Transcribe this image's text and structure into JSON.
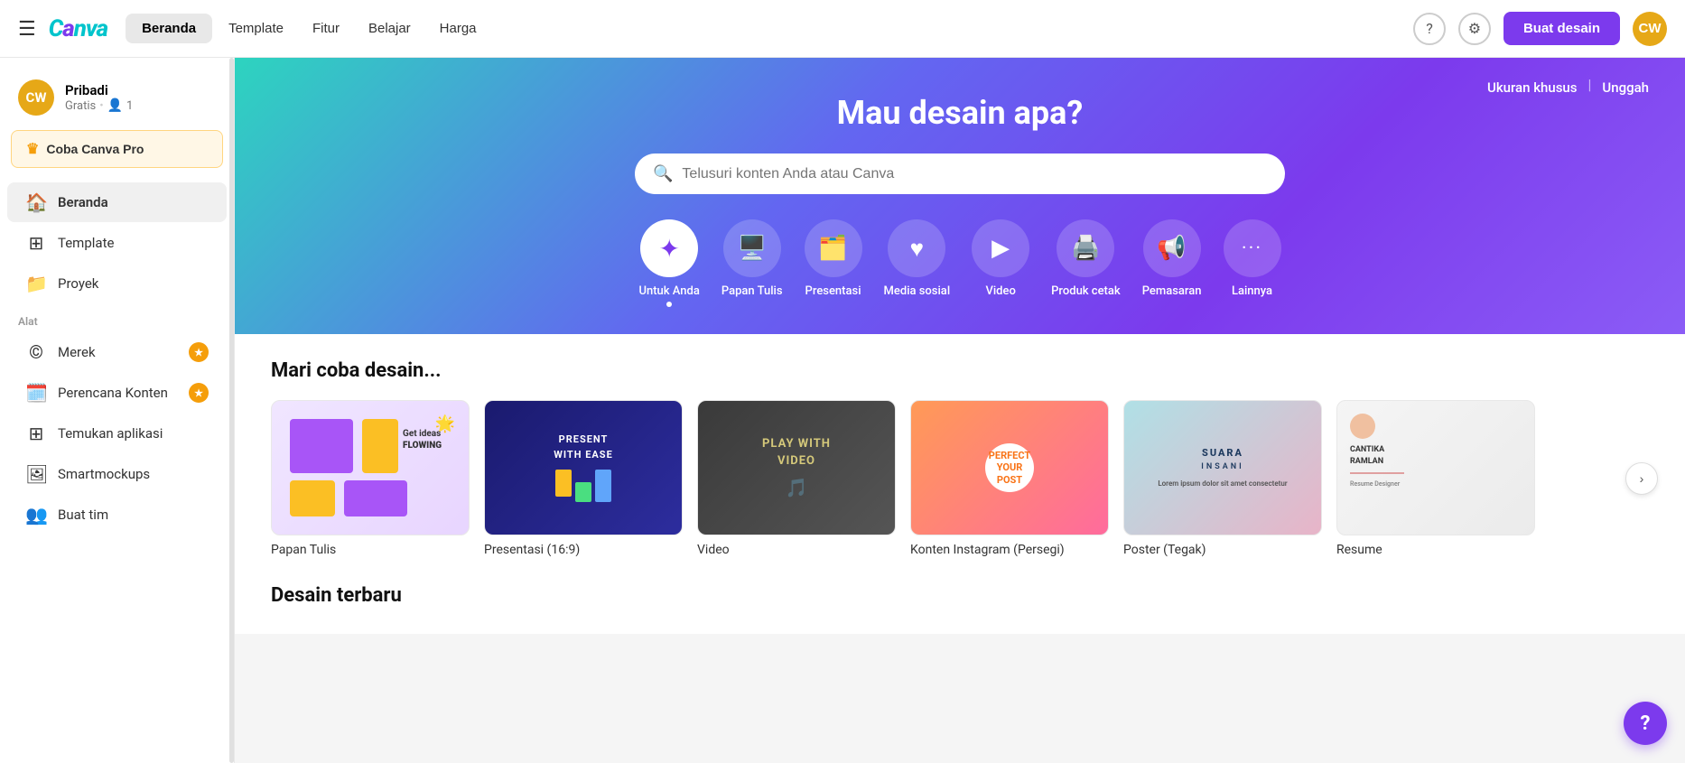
{
  "topnav": {
    "logo": "Canva",
    "beranda_label": "Beranda",
    "template_label": "Template",
    "fitur_label": "Fitur",
    "belajar_label": "Belajar",
    "harga_label": "Harga",
    "buat_desain_label": "Buat desain",
    "user_initials": "CW"
  },
  "sidebar": {
    "user_name": "Pribadi",
    "user_plan": "Gratis",
    "user_member_count": "1",
    "user_initials": "CW",
    "coba_canva_pro": "Coba Canva Pro",
    "nav_items": [
      {
        "id": "beranda",
        "label": "Beranda",
        "icon": "🏠",
        "active": true
      },
      {
        "id": "template",
        "label": "Template",
        "icon": "⊞",
        "active": false
      },
      {
        "id": "proyek",
        "label": "Proyek",
        "icon": "📁",
        "active": false
      }
    ],
    "section_alat": "Alat",
    "tool_items": [
      {
        "id": "merek",
        "label": "Merek",
        "icon": "©",
        "badge": true
      },
      {
        "id": "perencana-konten",
        "label": "Perencana Konten",
        "icon": "🗓️",
        "badge": true
      },
      {
        "id": "temukan-aplikasi",
        "label": "Temukan aplikasi",
        "icon": "⊞",
        "badge": false
      },
      {
        "id": "smartmockups",
        "label": "Smartmockups",
        "icon": "🖼",
        "badge": false
      },
      {
        "id": "buat-tim",
        "label": "Buat tim",
        "icon": "👥",
        "badge": false
      }
    ]
  },
  "hero": {
    "title": "Mau desain apa?",
    "search_placeholder": "Telusuri konten Anda atau Canva",
    "top_right_link1": "Ukuran khusus",
    "top_right_link2": "Unggah",
    "categories": [
      {
        "id": "untuk-anda",
        "label": "Untuk Anda",
        "icon": "✦",
        "active": true
      },
      {
        "id": "papan-tulis",
        "label": "Papan Tulis",
        "icon": "🖥"
      },
      {
        "id": "presentasi",
        "label": "Presentasi",
        "icon": "🗂"
      },
      {
        "id": "media-sosial",
        "label": "Media sosial",
        "icon": "♥"
      },
      {
        "id": "video",
        "label": "Video",
        "icon": "▶"
      },
      {
        "id": "produk-cetak",
        "label": "Produk cetak",
        "icon": "🖨"
      },
      {
        "id": "pemasaran",
        "label": "Pemasaran",
        "icon": "📢"
      },
      {
        "id": "lainnya",
        "label": "Lainnya",
        "icon": "···"
      }
    ]
  },
  "section_try": {
    "title": "Mari coba desain...",
    "cards": [
      {
        "id": "papan-tulis",
        "label": "Papan Tulis",
        "type": "whiteboard"
      },
      {
        "id": "presentasi",
        "label": "Presentasi (16:9)",
        "type": "presentation"
      },
      {
        "id": "video",
        "label": "Video",
        "type": "video"
      },
      {
        "id": "konten-instagram",
        "label": "Konten Instagram (Persegi)",
        "type": "instagram"
      },
      {
        "id": "poster",
        "label": "Poster (Tegak)",
        "type": "poster"
      },
      {
        "id": "resume",
        "label": "Resume",
        "type": "resume"
      }
    ]
  },
  "section_recent": {
    "title": "Desain terbaru"
  },
  "help_bubble": "?"
}
